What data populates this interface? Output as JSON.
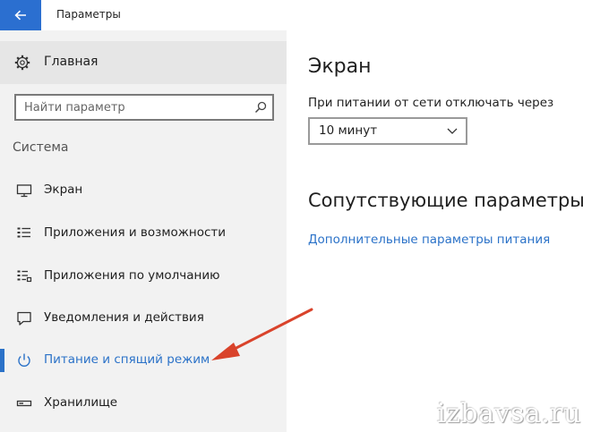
{
  "window": {
    "title": "Параметры",
    "back_icon": "arrow-left-icon"
  },
  "sidebar": {
    "home": {
      "label": "Главная",
      "icon": "gear-icon"
    },
    "search": {
      "placeholder": "Найти параметр",
      "icon": "search-icon"
    },
    "section": "Система",
    "items": [
      {
        "label": "Экран",
        "icon": "monitor-icon",
        "active": false
      },
      {
        "label": "Приложения и возможности",
        "icon": "list-icon",
        "active": false
      },
      {
        "label": "Приложения по умолчанию",
        "icon": "default-apps-icon",
        "active": false
      },
      {
        "label": "Уведомления и действия",
        "icon": "notification-icon",
        "active": false
      },
      {
        "label": "Питание и спящий режим",
        "icon": "power-icon",
        "active": true
      },
      {
        "label": "Хранилище",
        "icon": "storage-icon",
        "active": false
      }
    ]
  },
  "main": {
    "screen_heading": "Экран",
    "screen_field_label": "При питании от сети отключать через",
    "screen_timeout_value": "10 минут",
    "related_heading": "Сопутствующие параметры",
    "related_link": "Дополнительные параметры питания"
  },
  "watermark": "izbavsa.ru",
  "colors": {
    "accent": "#2b72c8",
    "back_button": "#2b6fd0",
    "annotation_arrow": "#d9432b",
    "sidebar_bg": "#f2f2f2"
  }
}
